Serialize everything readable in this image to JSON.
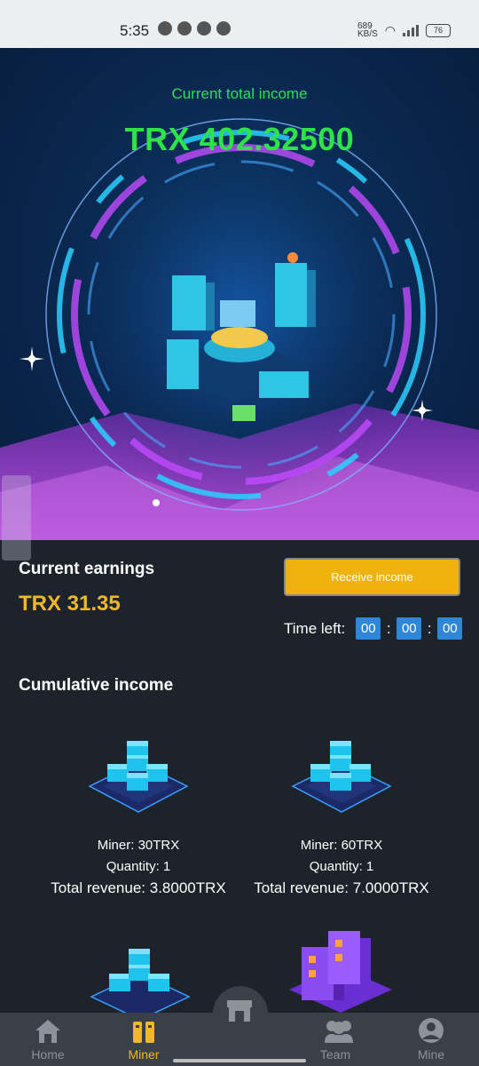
{
  "status_bar": {
    "time": "5:35",
    "net_speed": "689\nKB/S",
    "battery": "76"
  },
  "hero": {
    "title": "Current total income",
    "amount": "TRX 402.32500"
  },
  "earnings": {
    "title": "Current earnings",
    "value": "TRX 31.35",
    "receive_label": "Receive income",
    "time_left_label": "Time left:",
    "hours": "00",
    "minutes": "00",
    "seconds": "00"
  },
  "cumulative": {
    "title": "Cumulative income",
    "miners": [
      {
        "miner": "Miner: 30TRX",
        "quantity": "Quantity: 1",
        "revenue": "Total revenue: 3.8000TRX"
      },
      {
        "miner": "Miner: 60TRX",
        "quantity": "Quantity: 1",
        "revenue": "Total revenue: 7.0000TRX"
      }
    ]
  },
  "nav": {
    "items": [
      {
        "label": "Home",
        "icon": "home-icon"
      },
      {
        "label": "Miner",
        "icon": "miner-icon"
      },
      {
        "label": "",
        "icon": "store-icon"
      },
      {
        "label": "Team",
        "icon": "team-icon"
      },
      {
        "label": "Mine",
        "icon": "user-icon"
      }
    ]
  },
  "colors": {
    "accent": "#f0b72a",
    "income_green": "#2ee34a",
    "timer_blue": "#2f86d6",
    "background": "#1c232a"
  }
}
